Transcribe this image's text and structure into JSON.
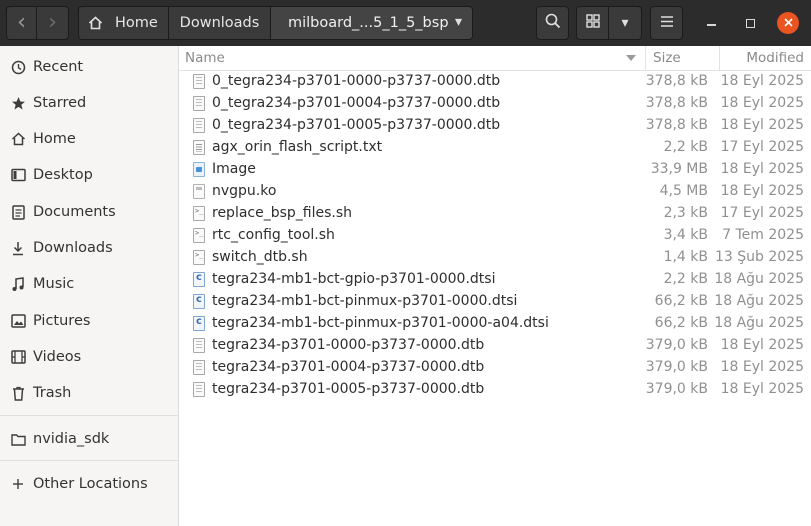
{
  "header": {
    "back_icon": "‹",
    "forward_icon": "›",
    "breadcrumbs": [
      "Home",
      "Downloads",
      "milboard_...5_1_5_bsp"
    ],
    "dropdown_icon": "▾",
    "search_icon": "search-icon",
    "view_icon": "grid-view-icon",
    "menu_icon": "menu-icon"
  },
  "sidebar": {
    "items": [
      {
        "label": "Recent",
        "icon": "clock-icon"
      },
      {
        "label": "Starred",
        "icon": "star-icon"
      },
      {
        "label": "Home",
        "icon": "home-icon"
      },
      {
        "label": "Desktop",
        "icon": "desktop-icon"
      },
      {
        "label": "Documents",
        "icon": "document-icon"
      },
      {
        "label": "Downloads",
        "icon": "download-icon"
      },
      {
        "label": "Music",
        "icon": "music-icon"
      },
      {
        "label": "Pictures",
        "icon": "picture-icon"
      },
      {
        "label": "Videos",
        "icon": "video-icon"
      },
      {
        "label": "Trash",
        "icon": "trash-icon"
      }
    ],
    "bookmarks": [
      {
        "label": "nvidia_sdk",
        "icon": "folder-icon"
      }
    ],
    "other_locations": {
      "label": "Other Locations",
      "icon": "plus-icon"
    }
  },
  "columns": {
    "name": "Name",
    "size": "Size",
    "modified": "Modified"
  },
  "files": [
    {
      "name": "0_tegra234-p3701-0000-p3737-0000.dtb",
      "size": "378,8 kB",
      "modified": "18 Eyl 2025",
      "type": "dtb"
    },
    {
      "name": "0_tegra234-p3701-0004-p3737-0000.dtb",
      "size": "378,8 kB",
      "modified": "18 Eyl 2025",
      "type": "dtb"
    },
    {
      "name": "0_tegra234-p3701-0005-p3737-0000.dtb",
      "size": "378,8 kB",
      "modified": "18 Eyl 2025",
      "type": "dtb"
    },
    {
      "name": "agx_orin_flash_script.txt",
      "size": "2,2 kB",
      "modified": "17 Eyl 2025",
      "type": "txt"
    },
    {
      "name": "Image",
      "size": "33,9 MB",
      "modified": "18 Eyl 2025",
      "type": "img"
    },
    {
      "name": "nvgpu.ko",
      "size": "4,5 MB",
      "modified": "18 Eyl 2025",
      "type": "ko"
    },
    {
      "name": "replace_bsp_files.sh",
      "size": "2,3 kB",
      "modified": "17 Eyl 2025",
      "type": "sh"
    },
    {
      "name": "rtc_config_tool.sh",
      "size": "3,4 kB",
      "modified": "7 Tem 2025",
      "type": "sh"
    },
    {
      "name": "switch_dtb.sh",
      "size": "1,4 kB",
      "modified": "13 Şub 2025",
      "type": "sh"
    },
    {
      "name": "tegra234-mb1-bct-gpio-p3701-0000.dtsi",
      "size": "2,2 kB",
      "modified": "18 Ağu 2025",
      "type": "c"
    },
    {
      "name": "tegra234-mb1-bct-pinmux-p3701-0000.dtsi",
      "size": "66,2 kB",
      "modified": "18 Ağu 2025",
      "type": "c"
    },
    {
      "name": "tegra234-mb1-bct-pinmux-p3701-0000-a04.dtsi",
      "size": "66,2 kB",
      "modified": "18 Ağu 2025",
      "type": "c"
    },
    {
      "name": "tegra234-p3701-0000-p3737-0000.dtb",
      "size": "379,0 kB",
      "modified": "18 Eyl 2025",
      "type": "dtb"
    },
    {
      "name": "tegra234-p3701-0004-p3737-0000.dtb",
      "size": "379,0 kB",
      "modified": "18 Eyl 2025",
      "type": "dtb"
    },
    {
      "name": "tegra234-p3701-0005-p3737-0000.dtb",
      "size": "379,0 kB",
      "modified": "18 Eyl 2025",
      "type": "dtb"
    }
  ],
  "colors": {
    "header_bg": "#2c2c2c",
    "sidebar_bg": "#f6f5f4",
    "close_button": "#e95420"
  }
}
